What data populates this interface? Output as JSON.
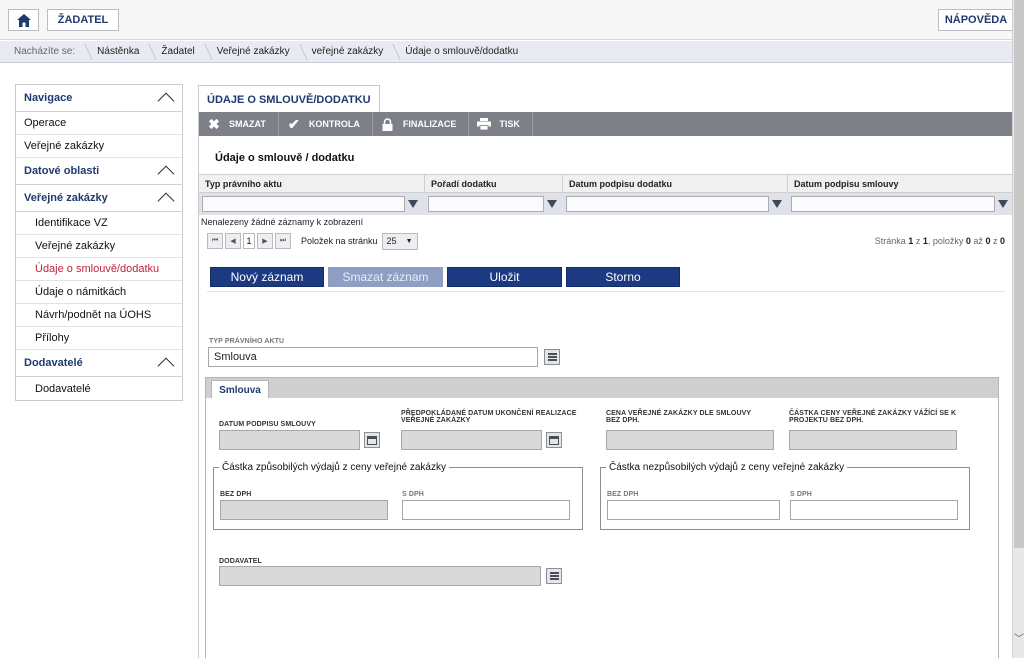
{
  "topbar": {
    "home_icon": "home-icon",
    "zadatel_label": "ŽADATEL",
    "help_label": "NÁPOVĚDA"
  },
  "breadcrumb": {
    "prefix": "Nacházíte se:",
    "items": [
      "Nástěnka",
      "Žadatel",
      "Veřejné zakázky",
      "veřejné zakázky",
      "Údaje o smlouvě/dodatku"
    ]
  },
  "sidebar": {
    "sections": [
      {
        "title": "Navigace",
        "items": [
          "Operace",
          "Veřejné zakázky"
        ]
      },
      {
        "title": "Datové oblasti",
        "items": []
      },
      {
        "title": "Veřejné zakázky",
        "items": [
          "Identifikace VZ",
          "Veřejné zakázky",
          "Údaje o smlouvě/dodatku",
          "Údaje o námitkách",
          "Návrh/podnět na ÚOHS",
          "Přílohy"
        ]
      },
      {
        "title": "Dodavatelé",
        "items": [
          "Dodavatelé"
        ]
      }
    ],
    "active_item": "Údaje o smlouvě/dodatku"
  },
  "main": {
    "tab_label": "ÚDAJE O SMLOUVĚ/DODATKU",
    "toolbar": {
      "delete_label": "SMAZAT",
      "check_label": "KONTROLA",
      "finalize_label": "FINALIZACE",
      "print_label": "TISK"
    },
    "section_title": "Údaje o smlouvě / dodatku",
    "grid": {
      "columns": [
        "Typ právního aktu",
        "Pořadí dodatku",
        "Datum podpisu dodatku",
        "Datum podpisu smlouvy"
      ],
      "empty_message": "Nenalezeny žádné záznamy k zobrazení"
    },
    "pager": {
      "current_page": "1",
      "per_page_label": "Položek na stránku",
      "per_page_value": "25",
      "info_prefix": "Stránka",
      "page": "1",
      "info_of": "z",
      "pages": "1",
      "info_items": ", položky",
      "from": "0",
      "info_to": "až",
      "to": "0",
      "info_of2": "z",
      "total": "0"
    },
    "actions": {
      "new_label": "Nový záznam",
      "delete_label": "Smazat záznam",
      "save_label": "Uložit",
      "cancel_label": "Storno"
    },
    "form": {
      "legal_act_type_label": "TYP PRÁVNÍHO AKTU",
      "legal_act_type_value": "Smlouva",
      "detail_tab": "Smlouva",
      "contract_sign_date_label": "DATUM PODPISU SMLOUVY",
      "expected_end_date_label": "PŘEDPOKLÁDANÉ DATUM UKONČENÍ REALIZACE VEŘEJNÉ ZAKÁZKY",
      "price_label": "CENA VEŘEJNÉ ZAKÁZKY DLE SMLOUVY BEZ DPH.",
      "project_amount_label": "ČÁSTKA CENY VEŘEJNÉ ZAKÁZKY VÁŽÍCÍ SE K PROJEKTU BEZ DPH.",
      "eligible_group": "Částka způsobilých výdajů z ceny veřejné zakázky",
      "ineligible_group": "Částka nezpůsobilých výdajů z ceny veřejné zakázky",
      "without_vat_label": "BEZ DPH",
      "with_vat_label": "S DPH",
      "supplier_label": "DODAVATEL"
    }
  }
}
